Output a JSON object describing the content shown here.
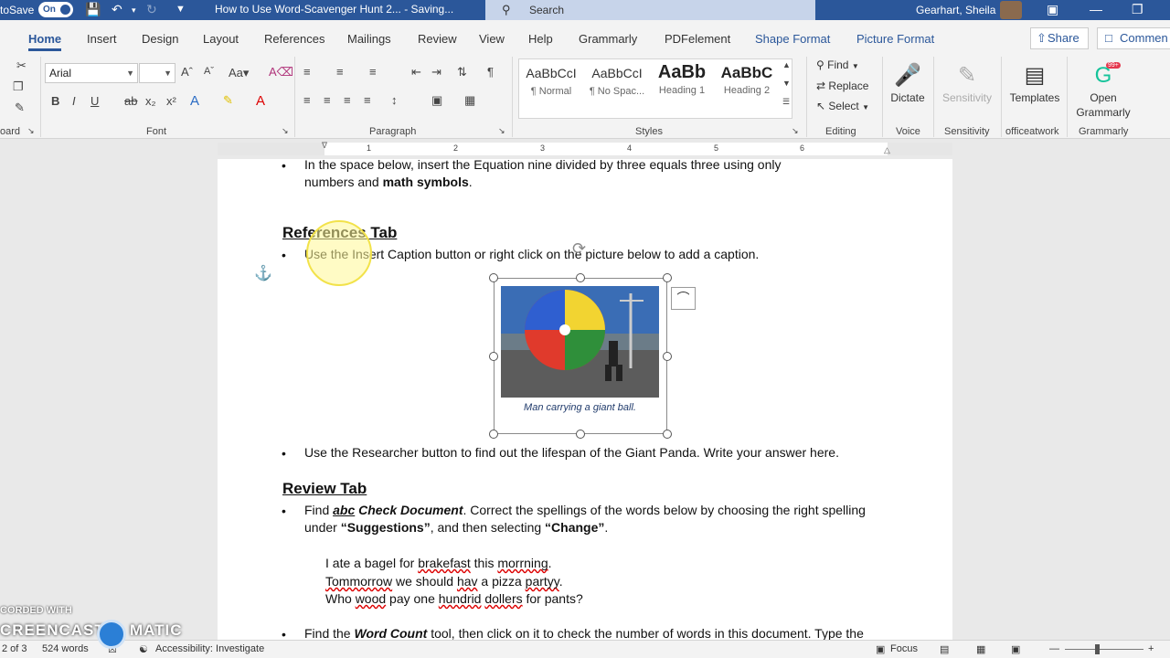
{
  "titlebar": {
    "autosave_label": "toSave",
    "toggle_label": "On",
    "doc_title": "How to Use Word-Scavenger Hunt 2... - Saving...",
    "search_placeholder": "Search",
    "user_name": "Gearhart, Sheila"
  },
  "tabs": {
    "items": [
      "Home",
      "Insert",
      "Design",
      "Layout",
      "References",
      "Mailings",
      "Review",
      "View",
      "Help",
      "Grammarly",
      "PDFelement",
      "Shape Format",
      "Picture Format"
    ],
    "share_label": "Share",
    "comments_label": "Commen"
  },
  "ribbon": {
    "font_name": "Arial",
    "font_size": "",
    "groups": {
      "clipboard": "oard",
      "font": "Font",
      "paragraph": "Paragraph",
      "styles": "Styles",
      "editing": "Editing",
      "voice": "Voice",
      "sensitivity": "Sensitivity",
      "officeatwork": "officeatwork",
      "grammarly": "Grammarly"
    },
    "styles": [
      {
        "preview": "AaBbCcI",
        "name": "¶ Normal"
      },
      {
        "preview": "AaBbCcI",
        "name": "¶ No Spac..."
      },
      {
        "preview": "AaBb",
        "name": "Heading 1"
      },
      {
        "preview": "AaBbC",
        "name": "Heading 2"
      }
    ],
    "editing": {
      "find": "Find",
      "replace": "Replace",
      "select": "Select"
    },
    "dictate_label": "Dictate",
    "sensitivity_label": "Sensitivity",
    "templates_label": "Templates",
    "open_grammarly_line1": "Open",
    "open_grammarly_line2": "Grammarly",
    "grammarly_badge": "99+"
  },
  "ruler": {
    "numbers": [
      "1",
      "2",
      "3",
      "4",
      "5",
      "6"
    ]
  },
  "document": {
    "line1a": "In the space below, insert the Equation nine divided by three equals three using only",
    "line1b_pre": "numbers and ",
    "line1b_bold": "math symbols",
    "line1b_post": ".",
    "heading_references": "References Tab",
    "caption_instruction": "Use the Insert Caption button or right click on the picture below to add a caption.",
    "picture_caption": "Man carrying a giant ball.",
    "researcher_line": "Use the Researcher button to find out the lifespan of the Giant Panda.  Write your answer here.",
    "heading_review": "Review Tab",
    "review_line1_pre": "Find ",
    "review_line1_abc": "abc",
    "review_line1_bold": " Check Document",
    "review_line1_post": ".  Correct the spellings of the words below by choosing the right spelling",
    "review_line2_pre": "under ",
    "review_line2_sugg": "“Suggestions”",
    "review_line2_mid": ", and then selecting ",
    "review_line2_change": "“Change”",
    "review_line2_post": ".",
    "s1_a": "I ate a bagel for ",
    "s1_err1": "brakefast",
    "s1_b": " this ",
    "s1_err2": "morrning",
    "s1_c": ".",
    "s2_err1": "Tommorrow",
    "s2_a": " we should ",
    "s2_err2": "hav",
    "s2_b": " a pizza ",
    "s2_err3": "partyy",
    "s2_c": ".",
    "s3_a": "Who ",
    "s3_err1": "wood",
    "s3_b": " pay one ",
    "s3_err2": "hundrid",
    "s3_c": " ",
    "s3_err3": "dollers",
    "s3_d": " for pants?",
    "wordcount_pre": "Find the ",
    "wordcount_bold": "Word Count",
    "wordcount_post": " tool, then click on it to check the number of words in this document. Type the"
  },
  "statusbar": {
    "page": "2 of 3",
    "words": "524 words",
    "accessibility": "Accessibility: Investigate",
    "focus": "Focus"
  },
  "watermark": {
    "line1": "CORDED WITH",
    "line2": "CREENCAST",
    "line3": "MATIC"
  }
}
